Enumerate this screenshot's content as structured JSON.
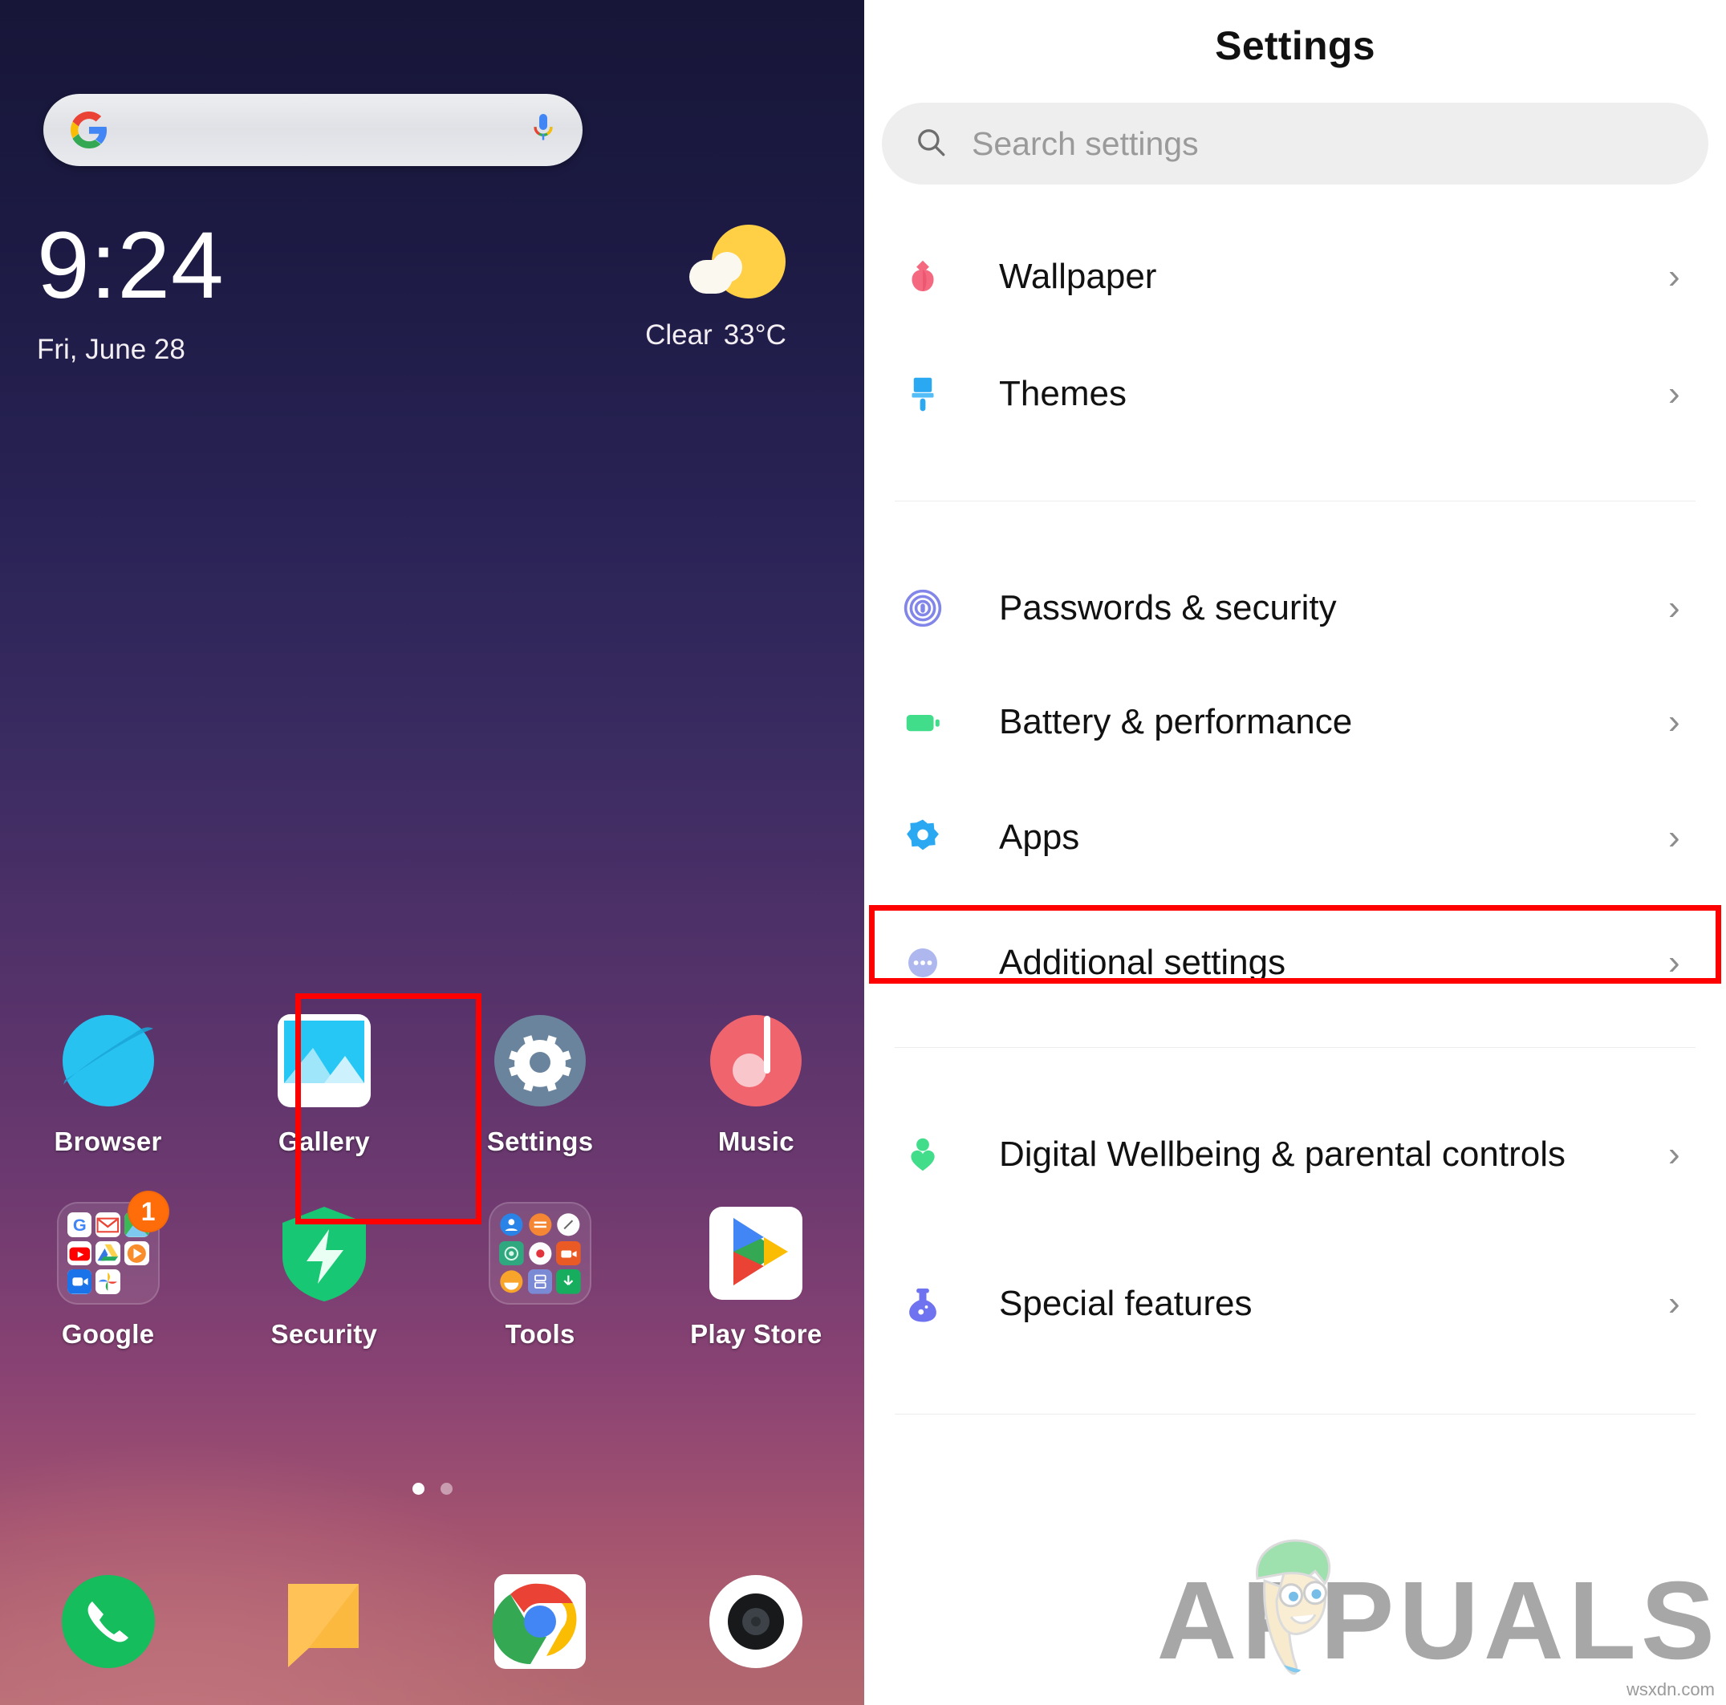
{
  "home": {
    "search_widget": {
      "name": "Google search",
      "google_icon": "google-g-icon",
      "mic_icon": "microphone-icon"
    },
    "clock": {
      "time": "9:24",
      "date": "Fri, June 28"
    },
    "weather": {
      "condition": "Clear",
      "temperature": "33°C",
      "icon": "sun-behind-cloud-icon"
    },
    "apps": [
      {
        "label": "Browser",
        "icon": "browser-planet-icon"
      },
      {
        "label": "Gallery",
        "icon": "gallery-photo-icon"
      },
      {
        "label": "Settings",
        "icon": "settings-gear-icon",
        "highlighted": true
      },
      {
        "label": "Music",
        "icon": "music-note-icon"
      },
      {
        "label": "Google",
        "icon": "google-folder-icon",
        "badge": "1"
      },
      {
        "label": "Security",
        "icon": "security-shield-icon"
      },
      {
        "label": "Tools",
        "icon": "tools-folder-icon"
      },
      {
        "label": "Play Store",
        "icon": "play-store-icon"
      }
    ],
    "page_dots": {
      "count": 2,
      "active_index": 0
    },
    "dock": [
      {
        "name": "phone-icon"
      },
      {
        "name": "messages-icon"
      },
      {
        "name": "chrome-icon"
      },
      {
        "name": "camera-icon"
      }
    ]
  },
  "settings": {
    "title": "Settings",
    "search": {
      "placeholder": "Search settings",
      "icon": "search-icon"
    },
    "groups": [
      {
        "items": [
          {
            "label": "Wallpaper",
            "icon": "tulip-icon",
            "color": "#f4697f"
          },
          {
            "label": "Themes",
            "icon": "paint-brush-icon",
            "color": "#2aa8f2"
          }
        ]
      },
      {
        "items": [
          {
            "label": "Passwords & security",
            "icon": "fingerprint-icon",
            "color": "#8286e8"
          },
          {
            "label": "Battery & performance",
            "icon": "battery-icon",
            "color": "#41dd8a"
          },
          {
            "label": "Apps",
            "icon": "apps-gear-icon",
            "color": "#2aa8f2",
            "highlighted": true
          },
          {
            "label": "Additional settings",
            "icon": "more-dots-icon",
            "color": "#aeb8ef"
          }
        ]
      },
      {
        "items": [
          {
            "label": "Digital Wellbeing & parental controls",
            "icon": "wellbeing-person-heart-icon",
            "color": "#41dd8a"
          },
          {
            "label": "Special features",
            "icon": "flask-icon",
            "color": "#6f73ef"
          }
        ]
      }
    ],
    "chevron": "›"
  },
  "watermark": {
    "text": "APPUALS",
    "url": "wsxdn.com"
  },
  "colors": {
    "highlight": "#ff0000",
    "accent_blue": "#2aa8f2",
    "badge_orange": "#ff6d0a"
  }
}
